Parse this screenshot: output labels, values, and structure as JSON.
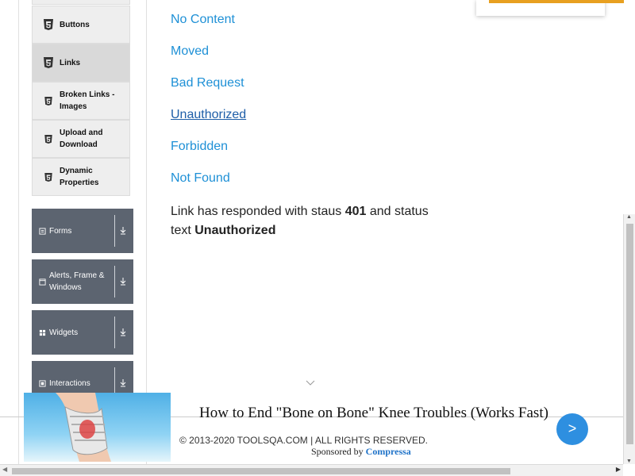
{
  "sidebar": {
    "sub_items": [
      {
        "label": "Buttons",
        "active": false
      },
      {
        "label": "Links",
        "active": true
      },
      {
        "label": "Broken Links - Images",
        "active": false
      },
      {
        "label": "Upload and Download",
        "active": false
      },
      {
        "label": "Dynamic Properties",
        "active": false
      }
    ],
    "groups": [
      {
        "label": "Forms"
      },
      {
        "label": "Alerts, Frame & Windows"
      },
      {
        "label": "Widgets"
      },
      {
        "label": "Interactions"
      }
    ]
  },
  "links": [
    {
      "label": "No Content"
    },
    {
      "label": "Moved"
    },
    {
      "label": "Bad Request"
    },
    {
      "label": "Unauthorized",
      "hovered": true
    },
    {
      "label": "Forbidden"
    },
    {
      "label": "Not Found"
    }
  ],
  "response": {
    "prefix": "Link has responded with staus",
    "status_code": "401",
    "middle": "and status text",
    "status_text": "Unauthorized"
  },
  "footer": {
    "copyright": "© 2013-2020 TOOLSQA.COM | ALL RIGHTS RESERVED."
  },
  "ad": {
    "title": "How to End \"Bone on Bone\" Knee Troubles (Works Fast)",
    "sponsored_by": "Sponsored by",
    "sponsor": "Compressa",
    "next_label": ">"
  },
  "colors": {
    "link": "#1e90d6",
    "group_bg": "#5c6470",
    "sub_bg": "#eeeeee",
    "ad_button": "#2e8fe0"
  }
}
